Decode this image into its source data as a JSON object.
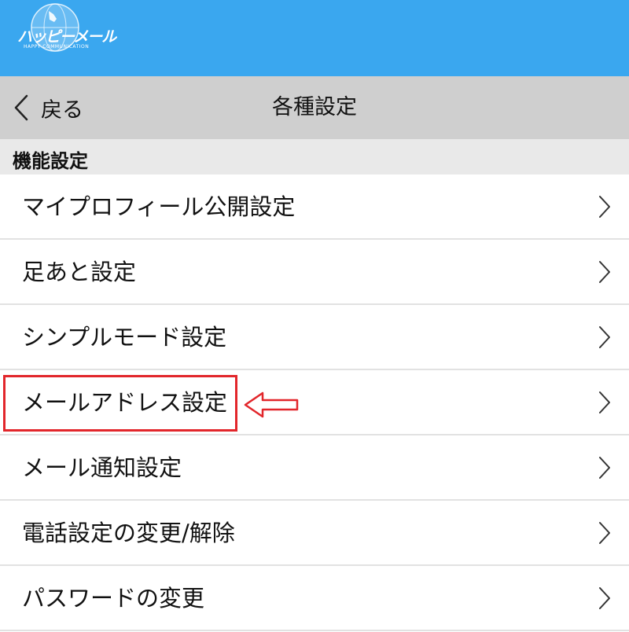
{
  "header": {
    "logo_text": "ハッピーメール",
    "logo_subtext": "HAPPY COMMUNICATION",
    "bg_color": "#3aa7ef"
  },
  "navbar": {
    "back_label": "戻る",
    "title": "各種設定"
  },
  "section": {
    "label": "機能設定"
  },
  "items": [
    {
      "label": "マイプロフィール公開設定"
    },
    {
      "label": "足あと設定"
    },
    {
      "label": "シンプルモード設定"
    },
    {
      "label": "メールアドレス設定"
    },
    {
      "label": "メール通知設定"
    },
    {
      "label": "電話設定の変更/解除"
    },
    {
      "label": "パスワードの変更"
    }
  ],
  "annotation": {
    "highlighted_item": "メールアドレス設定",
    "color": "#e2262b"
  }
}
